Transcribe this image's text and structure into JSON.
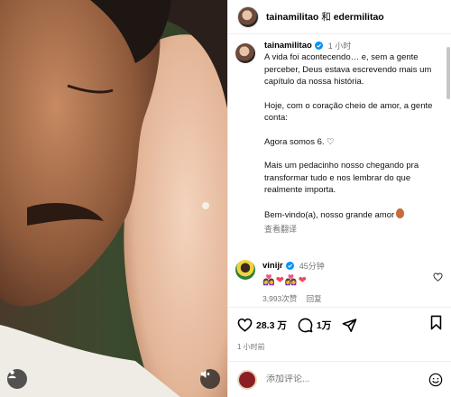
{
  "header": {
    "user1": "tainamilitao",
    "and": "和",
    "user2": "edermilitao"
  },
  "caption": {
    "username": "tainamilitao",
    "time": "1 小时",
    "lines": [
      "A vida foi acontecendo… e, sem a gente perceber, Deus estava escrevendo mais um capítulo da nossa história.",
      "Hoje, com o coração cheio de amor, a gente conta:",
      "Agora somos 6. ♡",
      "Mais um pedacinho nosso chegando pra transformar tudo e nos lembrar do que realmente importa.",
      "Bem-vindo(a), nosso grande amor"
    ],
    "translate": "查看翻译"
  },
  "comment": {
    "username": "vinijr",
    "time": "45分钟",
    "emojis": [
      "👩‍❤️‍👩",
      "❤",
      "👩‍❤️‍👩",
      "❤"
    ],
    "likes": "3,993次赞",
    "reply": "回复"
  },
  "actions": {
    "likes": "28.3 万",
    "comments": "1万",
    "posted": "1 小时前"
  },
  "add_comment": {
    "placeholder": "添加评论..."
  },
  "colors": {
    "verified": "#0095f6",
    "heart": "#ed4956",
    "muted": "#737373"
  }
}
